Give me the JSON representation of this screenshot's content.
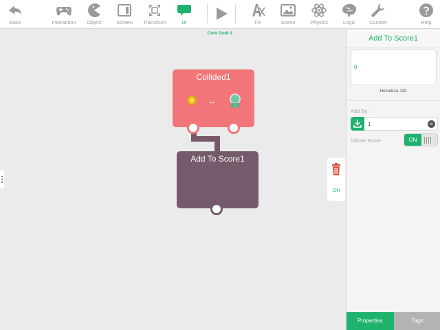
{
  "toolbar": {
    "back": "Back",
    "interaction": "Interaction",
    "object": "Object",
    "screen": "Screen",
    "transform": "Transform",
    "ui": "UI",
    "fx": "FX",
    "scene": "Scene",
    "physics": "Physics",
    "logic": "Logic",
    "custom": "Custom",
    "help": "Help"
  },
  "canvas": {
    "title": "Coin Gold-1",
    "collided_block": {
      "title": "Collided1"
    },
    "score_block": {
      "title": "Add To Score1"
    },
    "side_tab": {
      "on_label": "On"
    }
  },
  "panel": {
    "title": "Add To Score1",
    "preview_value": "0",
    "font_name": "Helvetica-110",
    "add_by_label": "Add By:",
    "add_by_value": "1",
    "infinite_score_label": "Infinite Score:",
    "toggle_label": "ON",
    "tabs": [
      "Properties",
      "Tags"
    ]
  },
  "colors": {
    "accent": "#1fb26d",
    "collided_block": "#f2757a",
    "score_block": "#745a6a",
    "delete": "#e24a3b"
  }
}
